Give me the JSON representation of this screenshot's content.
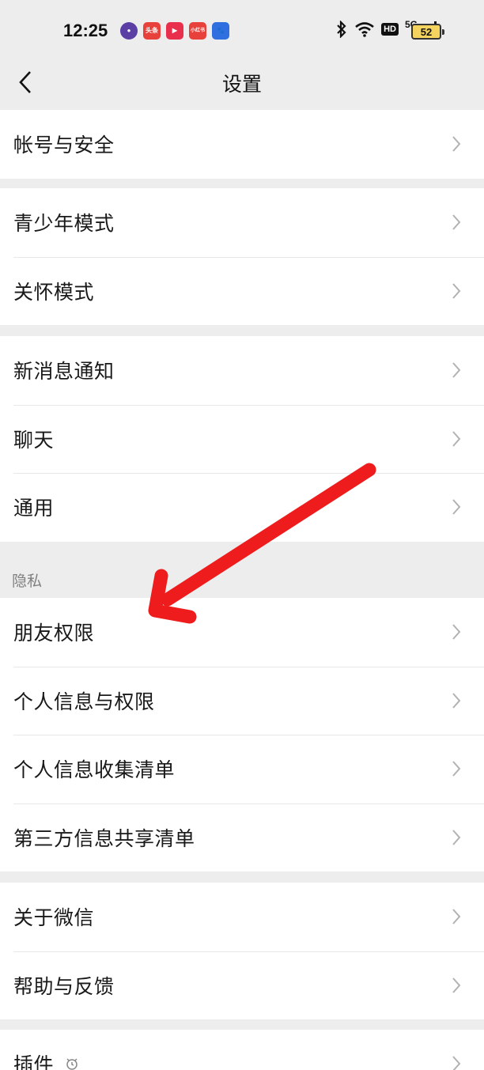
{
  "status_bar": {
    "time": "12:25",
    "apps": [
      {
        "icon": "purple-dot-app-icon",
        "label": "●",
        "color": "#5b3fa5"
      },
      {
        "icon": "toutiao-app-icon",
        "label": "头条",
        "color": "#e8413b"
      },
      {
        "icon": "video-app-icon",
        "label": "▶",
        "color": "#e8304d"
      },
      {
        "icon": "xiaohongshu-app-icon",
        "label": "小红书",
        "color": "#e8413b"
      },
      {
        "icon": "baidu-app-icon",
        "label": "🐾",
        "color": "#2f6fe0"
      }
    ],
    "hd": "HD",
    "network": "5G",
    "battery": "52"
  },
  "nav": {
    "title": "设置"
  },
  "groups": {
    "account": [
      "帐号与安全"
    ],
    "modes": [
      "青少年模式",
      "关怀模式"
    ],
    "general": [
      "新消息通知",
      "聊天",
      "通用"
    ],
    "privacy_title": "隐私",
    "privacy": [
      "朋友权限",
      "个人信息与权限",
      "个人信息收集清单",
      "第三方信息共享清单"
    ],
    "about": [
      "关于微信",
      "帮助与反馈"
    ],
    "plugins": [
      "插件"
    ]
  },
  "colors": {
    "background": "#ededed",
    "card": "#ffffff",
    "annotation_arrow": "#ee1c1c"
  }
}
